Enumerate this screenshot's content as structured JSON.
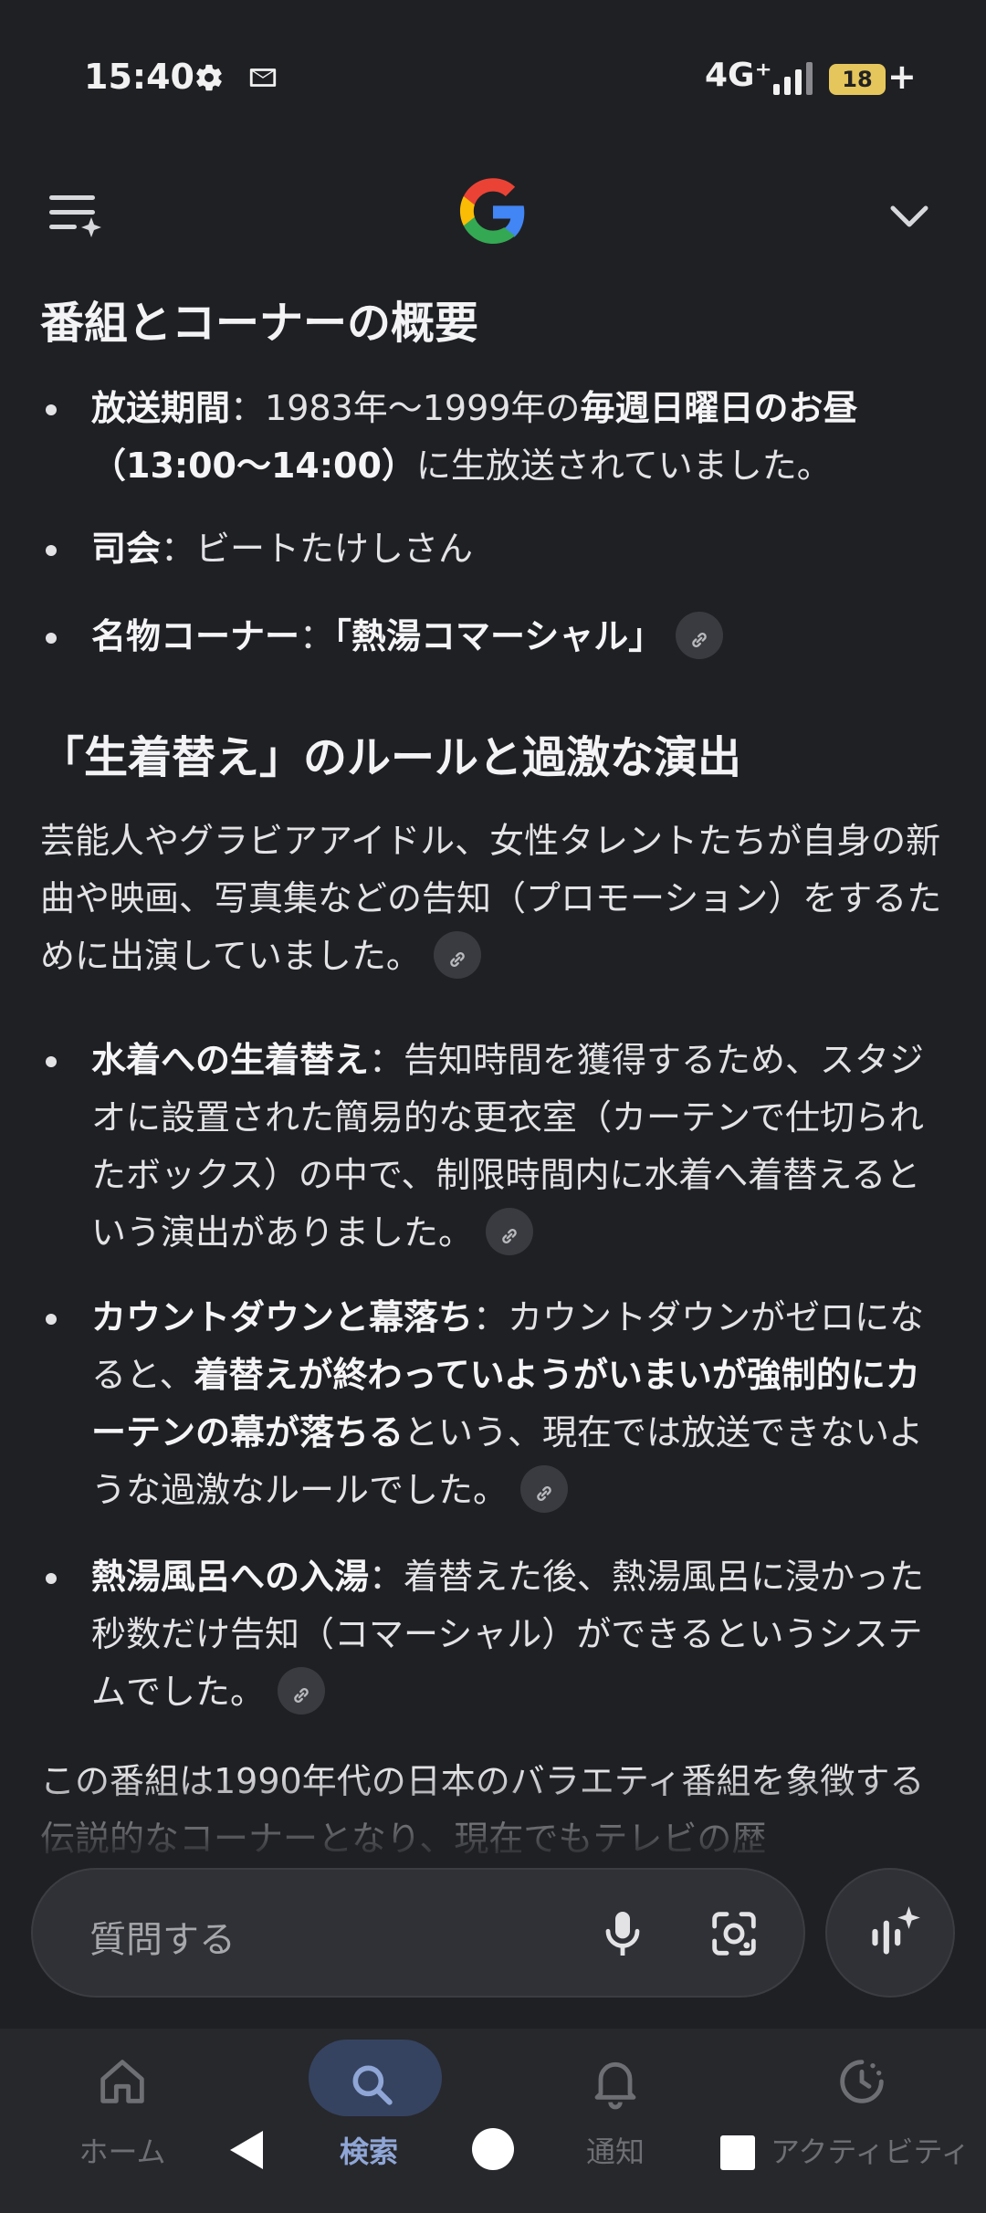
{
  "status": {
    "time": "15:40",
    "network": "4G⁺",
    "battery": "18",
    "battery_suffix": "+"
  },
  "header": {
    "menu_icon": "menu-sparkle-icon",
    "logo": "google-g-logo",
    "collapse_icon": "chevron-down-icon"
  },
  "sections": {
    "overview": {
      "heading": "番組とコーナーの概要",
      "b1_label": "放送期間",
      "b1_text1": "：1983年〜1999年の",
      "b1_bold": "毎週日曜日のお昼（13:00〜14:00）",
      "b1_text2": "に生放送されていました。",
      "b2_label": "司会",
      "b2_text": "：ビートたけしさん",
      "b3_label": "名物コーナー",
      "b3_sep": "：",
      "b3_bold": "「熱湯コマーシャル」"
    },
    "rules": {
      "heading": "「生着替え」のルールと過激な演出",
      "intro": "芸能人やグラビアアイドル、女性タレントたちが自身の新曲や映画、写真集などの告知（プロモーション）をするために出演していました。",
      "b1_label": "水着への生着替え",
      "b1_text": "：告知時間を獲得するため、スタジオに設置された簡易的な更衣室（カーテンで仕切られたボックス）の中で、制限時間内に水着へ着替えるという演出がありました。",
      "b2_label": "カウントダウンと幕落ち",
      "b2_text1": "：カウントダウンがゼロになると、",
      "b2_bold": "着替えが終わっていようがいまいが強制的にカーテンの幕が落ちる",
      "b2_text2": "という、現在では放送できないような過激なルールでした。",
      "b3_label": "熱湯風呂への入湯",
      "b3_text": "：着替えた後、熱湯風呂に浸かった秒数だけ告知（コマーシャル）ができるというシステムでした。"
    },
    "closing": "この番組は1990年代の日本のバラエティ番組を象徴する伝説的なコーナーとなり、現在でもテレビの歴"
  },
  "search": {
    "placeholder": "質問する"
  },
  "nav": {
    "home": "ホーム",
    "search": "検索",
    "notifications": "通知",
    "activity": "アクティビティ"
  },
  "colors": {
    "background": "#1f2024",
    "accent": "#8fa6d6",
    "battery": "#e5c65c"
  }
}
